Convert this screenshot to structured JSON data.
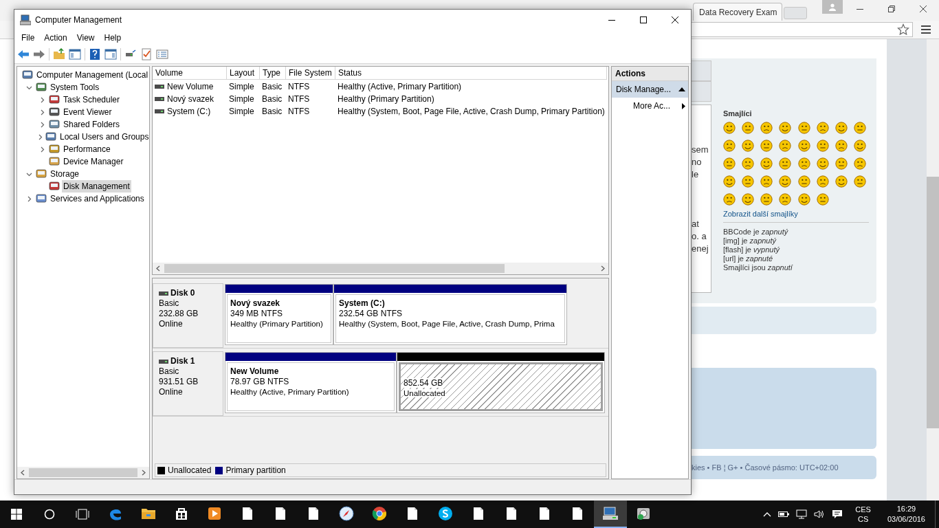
{
  "browser": {
    "last_tab": "Data Recovery Exam",
    "page": {
      "textarea_fragments": [
        "sem",
        "no",
        "le",
        "at",
        "o. a",
        "enej"
      ],
      "smileys_title": "Smajlíci",
      "more_smileys": "Zobrazit další smajlíky",
      "options": [
        "BBCode je *zapnutý*",
        "[img] je *zapnutý*",
        "[flash] je *vypnutý*",
        "[url] je *zapnuté*",
        "Smajlíci jsou *zapnutí*"
      ],
      "footer": "kies • FB ¦ G+ • Časové pásmo: UTC+02:00"
    }
  },
  "window": {
    "title": "Computer Management",
    "menu": [
      "File",
      "Action",
      "View",
      "Help"
    ],
    "tree": [
      {
        "label": "Computer Management (Local",
        "selected": false,
        "children": [
          {
            "label": "System Tools",
            "expandable": true,
            "expanded": true,
            "selected": false,
            "children": [
              {
                "label": "Task Scheduler",
                "expandable": true,
                "expanded": false,
                "selected": false
              },
              {
                "label": "Event Viewer",
                "expandable": true,
                "expanded": false,
                "selected": false
              },
              {
                "label": "Shared Folders",
                "expandable": true,
                "expanded": false,
                "selected": false
              },
              {
                "label": "Local Users and Groups",
                "expandable": true,
                "expanded": false,
                "selected": false
              },
              {
                "label": "Performance",
                "expandable": true,
                "expanded": false,
                "selected": false
              },
              {
                "label": "Device Manager",
                "selected": false
              }
            ]
          },
          {
            "label": "Storage",
            "expandable": true,
            "expanded": true,
            "selected": false,
            "children": [
              {
                "label": "Disk Management",
                "selected": true
              }
            ]
          },
          {
            "label": "Services and Applications",
            "expandable": true,
            "expanded": false,
            "selected": false
          }
        ]
      }
    ],
    "volumes": {
      "columns": [
        "Volume",
        "Layout",
        "Type",
        "File System",
        "Status"
      ],
      "rows": [
        [
          "New Volume",
          "Simple",
          "Basic",
          "NTFS",
          "Healthy (Active, Primary Partition)"
        ],
        [
          "Nový svazek",
          "Simple",
          "Basic",
          "NTFS",
          "Healthy (Primary Partition)"
        ],
        [
          "System  (C:)",
          "Simple",
          "Basic",
          "NTFS",
          "Healthy (System, Boot, Page File, Active, Crash Dump, Primary Partition)"
        ]
      ]
    },
    "disks": [
      {
        "name": "Disk 0",
        "type": "Basic",
        "size": "232.88 GB",
        "status": "Online",
        "partitions": [
          {
            "kind": "primary",
            "name": "Nový svazek",
            "size": "349 MB NTFS",
            "status": "Healthy (Primary Partition)"
          },
          {
            "kind": "primary",
            "name": "System   (C:)",
            "size": "232.54 GB NTFS",
            "status": "Healthy (System, Boot, Page File, Active, Crash Dump, Prima"
          }
        ]
      },
      {
        "name": "Disk 1",
        "type": "Basic",
        "size": "931.51 GB",
        "status": "Online",
        "partitions": [
          {
            "kind": "primary",
            "name": "New Volume",
            "size": "78.97 GB NTFS",
            "status": "Healthy (Active, Primary Partition)"
          },
          {
            "kind": "unallocated",
            "size": "852.54 GB",
            "status": "Unallocated"
          }
        ]
      }
    ],
    "legend": [
      {
        "label": "Unallocated",
        "color": "#000000"
      },
      {
        "label": "Primary partition",
        "color": "#000080"
      }
    ],
    "actions": {
      "title": "Actions",
      "items": [
        {
          "label": "Disk Manage...",
          "kind": "group",
          "selected": true
        },
        {
          "label": "More Ac...",
          "kind": "submenu",
          "selected": false
        }
      ]
    }
  },
  "taskbar": {
    "apps": [
      {
        "kind": "edge",
        "active": false
      },
      {
        "kind": "folder",
        "active": false
      },
      {
        "kind": "store",
        "active": false
      },
      {
        "kind": "media",
        "active": false
      },
      {
        "kind": "doc",
        "active": false
      },
      {
        "kind": "doc",
        "active": false
      },
      {
        "kind": "doc",
        "active": false
      },
      {
        "kind": "compass",
        "active": false
      },
      {
        "kind": "chrome",
        "active": false
      },
      {
        "kind": "doc",
        "active": false
      },
      {
        "kind": "skype",
        "active": false
      },
      {
        "kind": "doc",
        "active": false
      },
      {
        "kind": "doc",
        "active": false
      },
      {
        "kind": "doc",
        "active": false
      },
      {
        "kind": "doc",
        "active": false
      },
      {
        "kind": "computer",
        "active": true
      },
      {
        "kind": "recovery",
        "active": false
      }
    ],
    "language": "CES",
    "layout": "CS",
    "time": "16:29",
    "date": "03/06/2016"
  }
}
